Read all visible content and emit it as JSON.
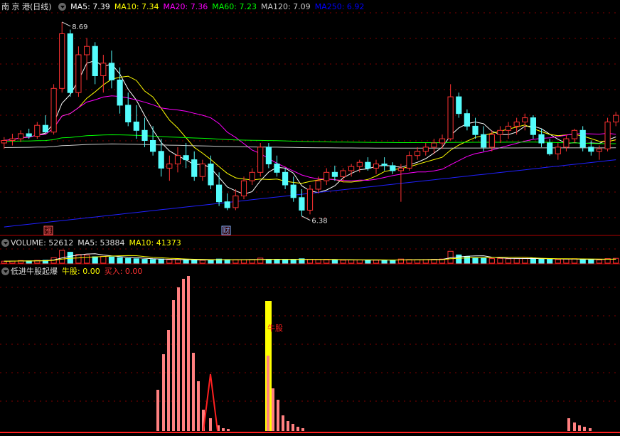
{
  "main_panel": {
    "stock_name": "南 京 港",
    "period": "(日线)",
    "ma_labels": [
      {
        "label": "MA5: 7.39",
        "color": "#ffffff"
      },
      {
        "label": "MA10: 7.34",
        "color": "#ffff00"
      },
      {
        "label": "MA20: 7.36",
        "color": "#ff00ff"
      },
      {
        "label": "MA60: 7.23",
        "color": "#00ff00"
      },
      {
        "label": "MA120: 7.09",
        "color": "#cccccc"
      },
      {
        "label": "MA250: 6.92",
        "color": "#0000ff"
      }
    ],
    "high_marker": "8.69",
    "low_marker": "6.38",
    "event_tags": [
      "涨",
      "财"
    ]
  },
  "volume_panel": {
    "title": "VOLUME: 52612",
    "ma5": "MA5: 53884",
    "ma10": "MA10: 41373"
  },
  "indicator_panel": {
    "title": "低进牛股起爆",
    "niu_label": "牛股: 0.00",
    "buy_label": "买入: 0.00",
    "signal_text": "牛股"
  },
  "colors": {
    "up": "#ff3232",
    "down": "#54fcfc",
    "grid": "#800000",
    "signal": "#ffff00",
    "bar": "#ff8080"
  },
  "chart_data": [
    {
      "type": "candlestick",
      "price_range": [
        6.2,
        8.8
      ],
      "candles": [
        [
          7.25,
          7.32,
          7.18,
          7.28
        ],
        [
          7.28,
          7.36,
          7.22,
          7.3
        ],
        [
          7.3,
          7.4,
          7.26,
          7.36
        ],
        [
          7.36,
          7.42,
          7.3,
          7.33
        ],
        [
          7.33,
          7.5,
          7.3,
          7.46
        ],
        [
          7.46,
          7.58,
          7.4,
          7.38
        ],
        [
          7.38,
          7.95,
          7.35,
          7.9
        ],
        [
          7.9,
          8.69,
          7.85,
          8.55
        ],
        [
          8.55,
          8.6,
          7.8,
          7.85
        ],
        [
          7.85,
          8.4,
          7.8,
          8.3
        ],
        [
          8.3,
          8.5,
          8.0,
          8.4
        ],
        [
          8.4,
          8.45,
          7.95,
          8.05
        ],
        [
          8.05,
          8.3,
          7.85,
          8.2
        ],
        [
          8.2,
          8.35,
          7.9,
          8.0
        ],
        [
          8.0,
          8.15,
          7.6,
          7.7
        ],
        [
          7.7,
          7.85,
          7.45,
          7.5
        ],
        [
          7.5,
          7.7,
          7.3,
          7.4
        ],
        [
          7.4,
          7.55,
          7.2,
          7.28
        ],
        [
          7.28,
          7.45,
          7.1,
          7.15
        ],
        [
          7.15,
          7.3,
          6.85,
          6.95
        ],
        [
          6.95,
          7.1,
          6.8,
          7.0
        ],
        [
          7.0,
          7.2,
          6.9,
          7.1
        ],
        [
          7.1,
          7.25,
          6.95,
          7.05
        ],
        [
          7.05,
          7.15,
          6.8,
          6.85
        ],
        [
          6.85,
          7.05,
          6.8,
          7.0
        ],
        [
          7.0,
          7.1,
          6.7,
          6.75
        ],
        [
          6.75,
          6.9,
          6.5,
          6.55
        ],
        [
          6.55,
          6.65,
          6.45,
          6.48
        ],
        [
          6.48,
          6.7,
          6.45,
          6.62
        ],
        [
          6.62,
          6.85,
          6.58,
          6.8
        ],
        [
          6.8,
          6.95,
          6.75,
          6.9
        ],
        [
          6.9,
          7.25,
          6.85,
          7.2
        ],
        [
          7.2,
          7.25,
          6.95,
          7.0
        ],
        [
          7.0,
          7.1,
          6.85,
          6.9
        ],
        [
          6.9,
          6.95,
          6.7,
          6.75
        ],
        [
          6.75,
          6.85,
          6.55,
          6.6
        ],
        [
          6.6,
          6.7,
          6.38,
          6.45
        ],
        [
          6.45,
          6.75,
          6.4,
          6.7
        ],
        [
          6.7,
          6.85,
          6.65,
          6.8
        ],
        [
          6.8,
          6.95,
          6.75,
          6.9
        ],
        [
          6.9,
          6.98,
          6.8,
          6.85
        ],
        [
          6.85,
          6.95,
          6.78,
          6.92
        ],
        [
          6.92,
          7.0,
          6.85,
          6.97
        ],
        [
          6.97,
          7.05,
          6.9,
          7.02
        ],
        [
          7.02,
          7.08,
          6.92,
          6.95
        ],
        [
          6.95,
          7.05,
          6.88,
          7.0
        ],
        [
          7.0,
          7.08,
          6.92,
          6.98
        ],
        [
          6.98,
          7.02,
          6.88,
          6.92
        ],
        [
          6.92,
          7.0,
          6.55,
          6.95
        ],
        [
          6.95,
          7.15,
          6.92,
          7.1
        ],
        [
          7.1,
          7.2,
          7.05,
          7.15
        ],
        [
          7.15,
          7.25,
          7.1,
          7.2
        ],
        [
          7.2,
          7.3,
          7.12,
          7.25
        ],
        [
          7.25,
          7.35,
          7.18,
          7.3
        ],
        [
          7.3,
          7.95,
          7.28,
          7.8
        ],
        [
          7.8,
          7.85,
          7.55,
          7.6
        ],
        [
          7.6,
          7.65,
          7.4,
          7.45
        ],
        [
          7.45,
          7.55,
          7.3,
          7.35
        ],
        [
          7.35,
          7.45,
          7.15,
          7.2
        ],
        [
          7.2,
          7.4,
          7.15,
          7.35
        ],
        [
          7.35,
          7.45,
          7.25,
          7.4
        ],
        [
          7.4,
          7.5,
          7.3,
          7.45
        ],
        [
          7.45,
          7.55,
          7.35,
          7.5
        ],
        [
          7.5,
          7.6,
          7.4,
          7.55
        ],
        [
          7.55,
          7.58,
          7.3,
          7.35
        ],
        [
          7.35,
          7.42,
          7.2,
          7.25
        ],
        [
          7.25,
          7.3,
          7.1,
          7.12
        ],
        [
          7.12,
          7.25,
          7.05,
          7.2
        ],
        [
          7.2,
          7.35,
          7.15,
          7.3
        ],
        [
          7.3,
          7.42,
          7.25,
          7.4
        ],
        [
          7.4,
          7.45,
          7.15,
          7.2
        ],
        [
          7.2,
          7.28,
          7.1,
          7.15
        ],
        [
          7.15,
          7.22,
          7.05,
          7.18
        ],
        [
          7.18,
          7.55,
          7.15,
          7.5
        ],
        [
          7.5,
          7.62,
          7.45,
          7.58
        ]
      ]
    },
    {
      "type": "bar",
      "title": "VOLUME: 52612",
      "values": [
        22000,
        23000,
        28000,
        25000,
        30000,
        32000,
        60000,
        140000,
        120000,
        95000,
        88000,
        70000,
        75000,
        68000,
        60000,
        52000,
        48000,
        42000,
        40000,
        45000,
        38000,
        35000,
        33000,
        36000,
        32000,
        38000,
        45000,
        40000,
        35000,
        38000,
        40000,
        55000,
        42000,
        38000,
        35000,
        40000,
        48000,
        42000,
        38000,
        36000,
        34000,
        33000,
        35000,
        36000,
        34000,
        33000,
        35000,
        32000,
        45000,
        40000,
        38000,
        40000,
        42000,
        45000,
        130000,
        90000,
        70000,
        60000,
        55000,
        50000,
        52000,
        48000,
        50000,
        52000,
        55000,
        45000,
        42000,
        40000,
        45000,
        48000,
        40000,
        38000,
        36000,
        50000,
        52612
      ]
    },
    {
      "type": "bar",
      "title": "低进牛股起爆",
      "series": [
        {
          "name": "牛股",
          "values": [
            0,
            0,
            0,
            0,
            0,
            0,
            0,
            0,
            0,
            0,
            0,
            0,
            0,
            0,
            0,
            0,
            0,
            0,
            0,
            0,
            0,
            0,
            0,
            0,
            0,
            0,
            0,
            0,
            0,
            0,
            0,
            0,
            0,
            0,
            0,
            0,
            0,
            0,
            0,
            0,
            0,
            0,
            0,
            0,
            0,
            0,
            0,
            0,
            0,
            0,
            0,
            0,
            0,
            0,
            0,
            0,
            0,
            0,
            0,
            0,
            0,
            0,
            0,
            0,
            0,
            0,
            0,
            0,
            0,
            0,
            0,
            0,
            0,
            0,
            0
          ]
        },
        {
          "name": "买入",
          "values": [
            0,
            0,
            0,
            0,
            0,
            0,
            0,
            0,
            0,
            0,
            0,
            0,
            0,
            0,
            0,
            0,
            0,
            0,
            0,
            0,
            0,
            0,
            0,
            0,
            0,
            0,
            0,
            0,
            0,
            0,
            0,
            0,
            0,
            0,
            0,
            0,
            0,
            0,
            0,
            0,
            0,
            0,
            0,
            0,
            0,
            0,
            0,
            0,
            0,
            0,
            0,
            0,
            0,
            0,
            0,
            0,
            0,
            0,
            0,
            0,
            0,
            0,
            0,
            0,
            0,
            0,
            0,
            0,
            0,
            0,
            0,
            0,
            0,
            0,
            0
          ]
        }
      ]
    }
  ]
}
